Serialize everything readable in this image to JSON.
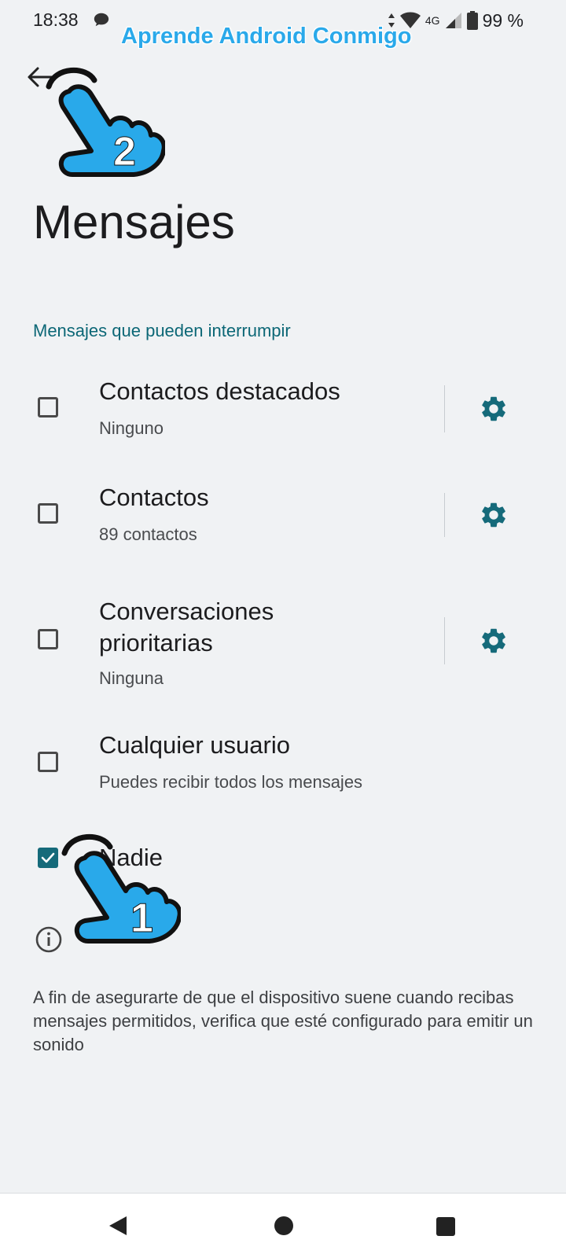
{
  "status_bar": {
    "time": "18:38",
    "network": "4G",
    "battery": "99 %"
  },
  "watermark": "Aprende Android Conmigo",
  "page_title": "Mensajes",
  "section_title": "Mensajes que pueden interrumpir",
  "options": [
    {
      "title": "Contactos destacados",
      "subtitle": "Ninguno",
      "checked": false,
      "has_settings": true
    },
    {
      "title": "Contactos",
      "subtitle": "89 contactos",
      "checked": false,
      "has_settings": true
    },
    {
      "title": "Conversaciones prioritarias",
      "subtitle": "Ninguna",
      "checked": false,
      "has_settings": true
    },
    {
      "title": "Cualquier usuario",
      "subtitle": "Puedes recibir todos los mensajes",
      "checked": false,
      "has_settings": false
    },
    {
      "title": "Nadie",
      "subtitle": "",
      "checked": true,
      "has_settings": false
    }
  ],
  "info_text": "A fin de asegurarte de que el dispositivo suene cuando recibas mensajes permitidos, verifica que esté configurado para emitir un sonido",
  "annotations": {
    "step_1": "1",
    "step_2": "2"
  },
  "colors": {
    "accent": "#156a7a",
    "section": "#0c6776",
    "watermark": "#2aa9ea",
    "hand": "#29a9ea"
  }
}
